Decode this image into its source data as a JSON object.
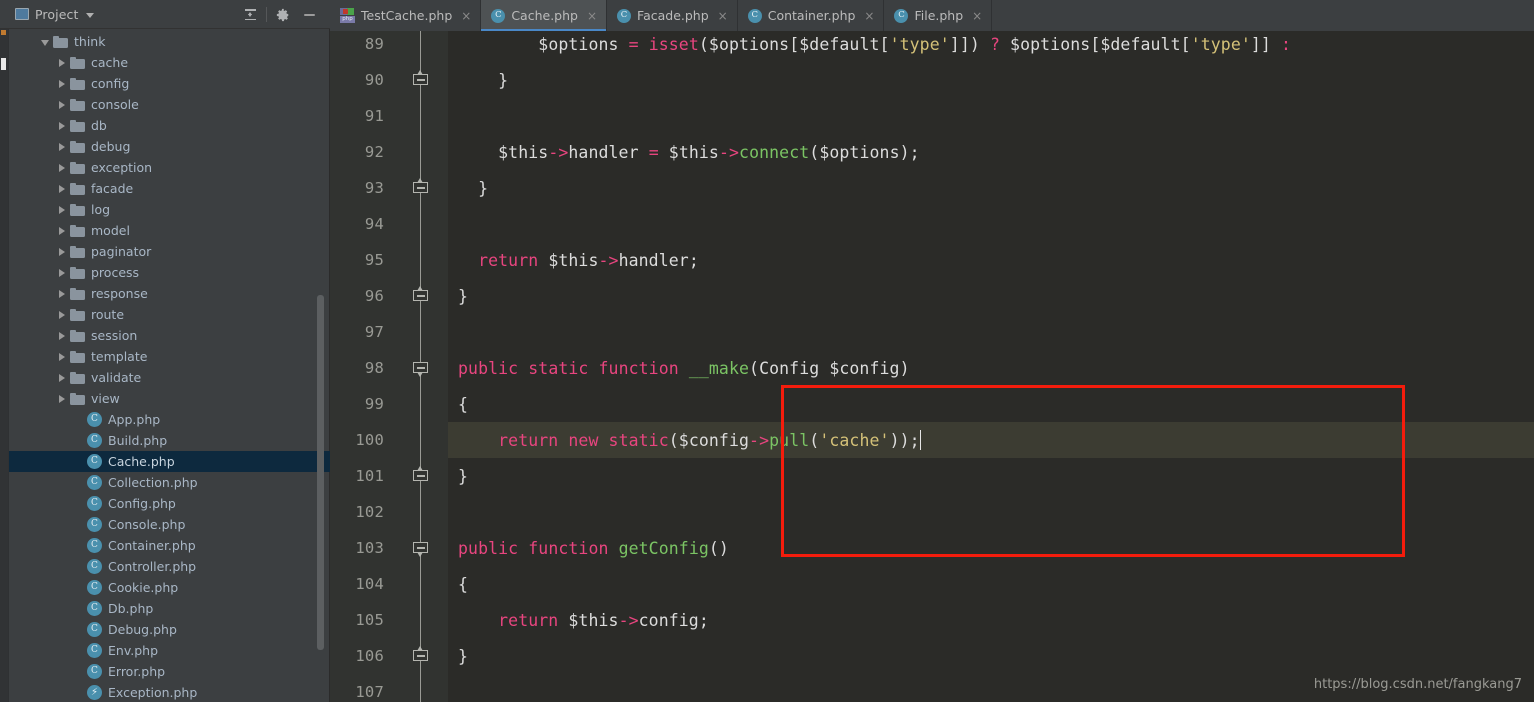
{
  "panel": {
    "title": "Project",
    "icons": {
      "project": "project-window-icon",
      "collapse_all": "collapse-all-icon",
      "settings": "gear-icon",
      "minimize": "minimize-icon",
      "dropdown": "chevron-down-icon"
    },
    "tree": [
      {
        "label": "think",
        "type": "folder",
        "indent": 2,
        "state": "expanded",
        "selected": false
      },
      {
        "label": "cache",
        "type": "folder",
        "indent": 3,
        "state": "collapsed",
        "selected": false
      },
      {
        "label": "config",
        "type": "folder",
        "indent": 3,
        "state": "collapsed",
        "selected": false
      },
      {
        "label": "console",
        "type": "folder",
        "indent": 3,
        "state": "collapsed",
        "selected": false
      },
      {
        "label": "db",
        "type": "folder",
        "indent": 3,
        "state": "collapsed",
        "selected": false
      },
      {
        "label": "debug",
        "type": "folder",
        "indent": 3,
        "state": "collapsed",
        "selected": false
      },
      {
        "label": "exception",
        "type": "folder",
        "indent": 3,
        "state": "collapsed",
        "selected": false
      },
      {
        "label": "facade",
        "type": "folder",
        "indent": 3,
        "state": "collapsed",
        "selected": false
      },
      {
        "label": "log",
        "type": "folder",
        "indent": 3,
        "state": "collapsed",
        "selected": false
      },
      {
        "label": "model",
        "type": "folder",
        "indent": 3,
        "state": "collapsed",
        "selected": false
      },
      {
        "label": "paginator",
        "type": "folder",
        "indent": 3,
        "state": "collapsed",
        "selected": false
      },
      {
        "label": "process",
        "type": "folder",
        "indent": 3,
        "state": "collapsed",
        "selected": false
      },
      {
        "label": "response",
        "type": "folder",
        "indent": 3,
        "state": "collapsed",
        "selected": false
      },
      {
        "label": "route",
        "type": "folder",
        "indent": 3,
        "state": "collapsed",
        "selected": false
      },
      {
        "label": "session",
        "type": "folder",
        "indent": 3,
        "state": "collapsed",
        "selected": false
      },
      {
        "label": "template",
        "type": "folder",
        "indent": 3,
        "state": "collapsed",
        "selected": false
      },
      {
        "label": "validate",
        "type": "folder",
        "indent": 3,
        "state": "collapsed",
        "selected": false
      },
      {
        "label": "view",
        "type": "folder",
        "indent": 3,
        "state": "collapsed",
        "selected": false
      },
      {
        "label": "App.php",
        "type": "class",
        "indent": 4,
        "state": "leaf",
        "selected": false
      },
      {
        "label": "Build.php",
        "type": "class",
        "indent": 4,
        "state": "leaf",
        "selected": false
      },
      {
        "label": "Cache.php",
        "type": "class",
        "indent": 4,
        "state": "leaf",
        "selected": true
      },
      {
        "label": "Collection.php",
        "type": "class",
        "indent": 4,
        "state": "leaf",
        "selected": false
      },
      {
        "label": "Config.php",
        "type": "class",
        "indent": 4,
        "state": "leaf",
        "selected": false
      },
      {
        "label": "Console.php",
        "type": "class",
        "indent": 4,
        "state": "leaf",
        "selected": false
      },
      {
        "label": "Container.php",
        "type": "class",
        "indent": 4,
        "state": "leaf",
        "selected": false
      },
      {
        "label": "Controller.php",
        "type": "class",
        "indent": 4,
        "state": "leaf",
        "selected": false
      },
      {
        "label": "Cookie.php",
        "type": "class",
        "indent": 4,
        "state": "leaf",
        "selected": false
      },
      {
        "label": "Db.php",
        "type": "class",
        "indent": 4,
        "state": "leaf",
        "selected": false
      },
      {
        "label": "Debug.php",
        "type": "class",
        "indent": 4,
        "state": "leaf",
        "selected": false
      },
      {
        "label": "Env.php",
        "type": "class",
        "indent": 4,
        "state": "leaf",
        "selected": false
      },
      {
        "label": "Error.php",
        "type": "class",
        "indent": 4,
        "state": "leaf",
        "selected": false
      },
      {
        "label": "Exception.php",
        "type": "exception",
        "indent": 4,
        "state": "leaf",
        "selected": false
      }
    ]
  },
  "tabs": [
    {
      "label": "TestCache.php",
      "icon": "php-test-file-icon",
      "active": false,
      "close": "×"
    },
    {
      "label": "Cache.php",
      "icon": "php-class-file-icon",
      "active": true,
      "close": "×"
    },
    {
      "label": "Facade.php",
      "icon": "php-class-file-icon",
      "active": false,
      "close": "×"
    },
    {
      "label": "Container.php",
      "icon": "php-class-file-icon",
      "active": false,
      "close": "×"
    },
    {
      "label": "File.php",
      "icon": "php-class-file-icon",
      "active": false,
      "close": "×"
    }
  ],
  "editor": {
    "first_line": 89,
    "current_line": 100,
    "lines": [
      {
        "num": 89,
        "fold": "none",
        "current": false,
        "tokens": [
          {
            "t": "        ",
            "c": "plain"
          },
          {
            "t": "$options",
            "c": "plain"
          },
          {
            "t": " ",
            "c": "plain"
          },
          {
            "t": "=",
            "c": "op"
          },
          {
            "t": " ",
            "c": "plain"
          },
          {
            "t": "isset",
            "c": "kw"
          },
          {
            "t": "(",
            "c": "plain"
          },
          {
            "t": "$options",
            "c": "plain"
          },
          {
            "t": "[",
            "c": "plain"
          },
          {
            "t": "$default",
            "c": "plain"
          },
          {
            "t": "[",
            "c": "plain"
          },
          {
            "t": "'type'",
            "c": "str"
          },
          {
            "t": "]])",
            "c": "plain"
          },
          {
            "t": " ",
            "c": "plain"
          },
          {
            "t": "?",
            "c": "op"
          },
          {
            "t": " ",
            "c": "plain"
          },
          {
            "t": "$options",
            "c": "plain"
          },
          {
            "t": "[",
            "c": "plain"
          },
          {
            "t": "$default",
            "c": "plain"
          },
          {
            "t": "[",
            "c": "plain"
          },
          {
            "t": "'type'",
            "c": "str"
          },
          {
            "t": "]]",
            "c": "plain"
          },
          {
            "t": " ",
            "c": "plain"
          },
          {
            "t": ":",
            "c": "op"
          }
        ]
      },
      {
        "num": 90,
        "fold": "close",
        "current": false,
        "tokens": [
          {
            "t": "    }",
            "c": "plain"
          }
        ]
      },
      {
        "num": 91,
        "fold": "none",
        "current": false,
        "tokens": []
      },
      {
        "num": 92,
        "fold": "none",
        "current": false,
        "tokens": [
          {
            "t": "    ",
            "c": "plain"
          },
          {
            "t": "$this",
            "c": "plain"
          },
          {
            "t": "->",
            "c": "op"
          },
          {
            "t": "handler",
            "c": "plain"
          },
          {
            "t": " ",
            "c": "plain"
          },
          {
            "t": "=",
            "c": "op"
          },
          {
            "t": " ",
            "c": "plain"
          },
          {
            "t": "$this",
            "c": "plain"
          },
          {
            "t": "->",
            "c": "op"
          },
          {
            "t": "connect",
            "c": "fn"
          },
          {
            "t": "(",
            "c": "plain"
          },
          {
            "t": "$options",
            "c": "plain"
          },
          {
            "t": ");",
            "c": "plain"
          }
        ]
      },
      {
        "num": 93,
        "fold": "close",
        "current": false,
        "tokens": [
          {
            "t": "  }",
            "c": "plain"
          }
        ]
      },
      {
        "num": 94,
        "fold": "none",
        "current": false,
        "tokens": []
      },
      {
        "num": 95,
        "fold": "none",
        "current": false,
        "tokens": [
          {
            "t": "  ",
            "c": "plain"
          },
          {
            "t": "return",
            "c": "kw"
          },
          {
            "t": " ",
            "c": "plain"
          },
          {
            "t": "$this",
            "c": "plain"
          },
          {
            "t": "->",
            "c": "op"
          },
          {
            "t": "handler",
            "c": "plain"
          },
          {
            "t": ";",
            "c": "plain"
          }
        ]
      },
      {
        "num": 96,
        "fold": "close",
        "current": false,
        "tokens": [
          {
            "t": "}",
            "c": "plain"
          }
        ]
      },
      {
        "num": 97,
        "fold": "none",
        "current": false,
        "tokens": []
      },
      {
        "num": 98,
        "fold": "open",
        "current": false,
        "tokens": [
          {
            "t": "public",
            "c": "kw"
          },
          {
            "t": " ",
            "c": "plain"
          },
          {
            "t": "static",
            "c": "kw"
          },
          {
            "t": " ",
            "c": "plain"
          },
          {
            "t": "function",
            "c": "kw"
          },
          {
            "t": " ",
            "c": "plain"
          },
          {
            "t": "__make",
            "c": "fn"
          },
          {
            "t": "(",
            "c": "plain"
          },
          {
            "t": "Config",
            "c": "plain"
          },
          {
            "t": " ",
            "c": "plain"
          },
          {
            "t": "$config",
            "c": "plain"
          },
          {
            "t": ")",
            "c": "plain"
          }
        ]
      },
      {
        "num": 99,
        "fold": "none",
        "current": false,
        "tokens": [
          {
            "t": "{",
            "c": "plain"
          }
        ]
      },
      {
        "num": 100,
        "fold": "none",
        "current": true,
        "tokens": [
          {
            "t": "    ",
            "c": "plain"
          },
          {
            "t": "return",
            "c": "kw"
          },
          {
            "t": " ",
            "c": "plain"
          },
          {
            "t": "new",
            "c": "kw"
          },
          {
            "t": " ",
            "c": "plain"
          },
          {
            "t": "static",
            "c": "kw"
          },
          {
            "t": "(",
            "c": "plain"
          },
          {
            "t": "$config",
            "c": "plain"
          },
          {
            "t": "->",
            "c": "op"
          },
          {
            "t": "pull",
            "c": "fn"
          },
          {
            "t": "(",
            "c": "plain"
          },
          {
            "t": "'cache'",
            "c": "str"
          },
          {
            "t": "));",
            "c": "plain"
          }
        ],
        "caret": true
      },
      {
        "num": 101,
        "fold": "close",
        "current": false,
        "tokens": [
          {
            "t": "}",
            "c": "plain"
          }
        ]
      },
      {
        "num": 102,
        "fold": "none",
        "current": false,
        "tokens": []
      },
      {
        "num": 103,
        "fold": "open",
        "current": false,
        "tokens": [
          {
            "t": "public",
            "c": "kw"
          },
          {
            "t": " ",
            "c": "plain"
          },
          {
            "t": "function",
            "c": "kw"
          },
          {
            "t": " ",
            "c": "plain"
          },
          {
            "t": "getConfig",
            "c": "fn"
          },
          {
            "t": "()",
            "c": "plain"
          }
        ]
      },
      {
        "num": 104,
        "fold": "none",
        "current": false,
        "tokens": [
          {
            "t": "{",
            "c": "plain"
          }
        ]
      },
      {
        "num": 105,
        "fold": "none",
        "current": false,
        "tokens": [
          {
            "t": "    ",
            "c": "plain"
          },
          {
            "t": "return",
            "c": "kw"
          },
          {
            "t": " ",
            "c": "plain"
          },
          {
            "t": "$this",
            "c": "plain"
          },
          {
            "t": "->",
            "c": "op"
          },
          {
            "t": "config",
            "c": "plain"
          },
          {
            "t": ";",
            "c": "plain"
          }
        ]
      },
      {
        "num": 106,
        "fold": "close",
        "current": false,
        "tokens": [
          {
            "t": "}",
            "c": "plain"
          }
        ]
      },
      {
        "num": 107,
        "fold": "none",
        "current": false,
        "tokens": []
      }
    ],
    "annotation": {
      "shape": "rectangle",
      "color": "#f41c0c",
      "covers_lines": [
        98,
        101
      ]
    }
  },
  "watermark": "https://blog.csdn.net/fangkang7",
  "colors": {
    "panel_bg": "#3c3f41",
    "editor_bg": "#2b2b28",
    "gutter_bg": "#313330",
    "current_line": "#3c3c32",
    "selection": "#0d293e",
    "tab_active": "#4e5254",
    "accent": "#4a88c7",
    "keyword": "#e8457f",
    "function": "#7bc464",
    "string": "#d4c178",
    "annotation": "#f41c0c"
  }
}
